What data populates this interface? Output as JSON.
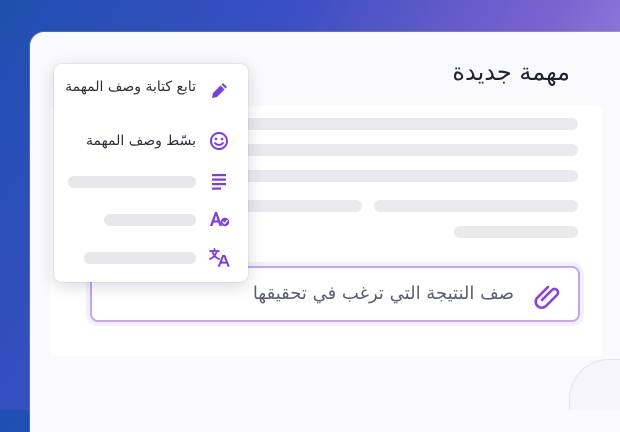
{
  "page": {
    "title": "مهمة جديدة"
  },
  "prompt": {
    "placeholder": "صف النتيجة التي ترغب في تحقيقها",
    "icon": "paperclip-icon"
  },
  "menu": {
    "items": [
      {
        "label": "تابع كتابة وصف المهمة",
        "icon": "pencil-icon"
      },
      {
        "label": "بسّط وصف المهمة",
        "icon": "smiley-icon"
      },
      {
        "label": "",
        "icon": "text-lines-icon"
      },
      {
        "label": "",
        "icon": "spellcheck-icon"
      },
      {
        "label": "",
        "icon": "translate-icon"
      }
    ]
  },
  "colors": {
    "accent": "#7c3aed",
    "accent_light": "#c2a6f4",
    "skeleton": "#e9e9ee"
  }
}
